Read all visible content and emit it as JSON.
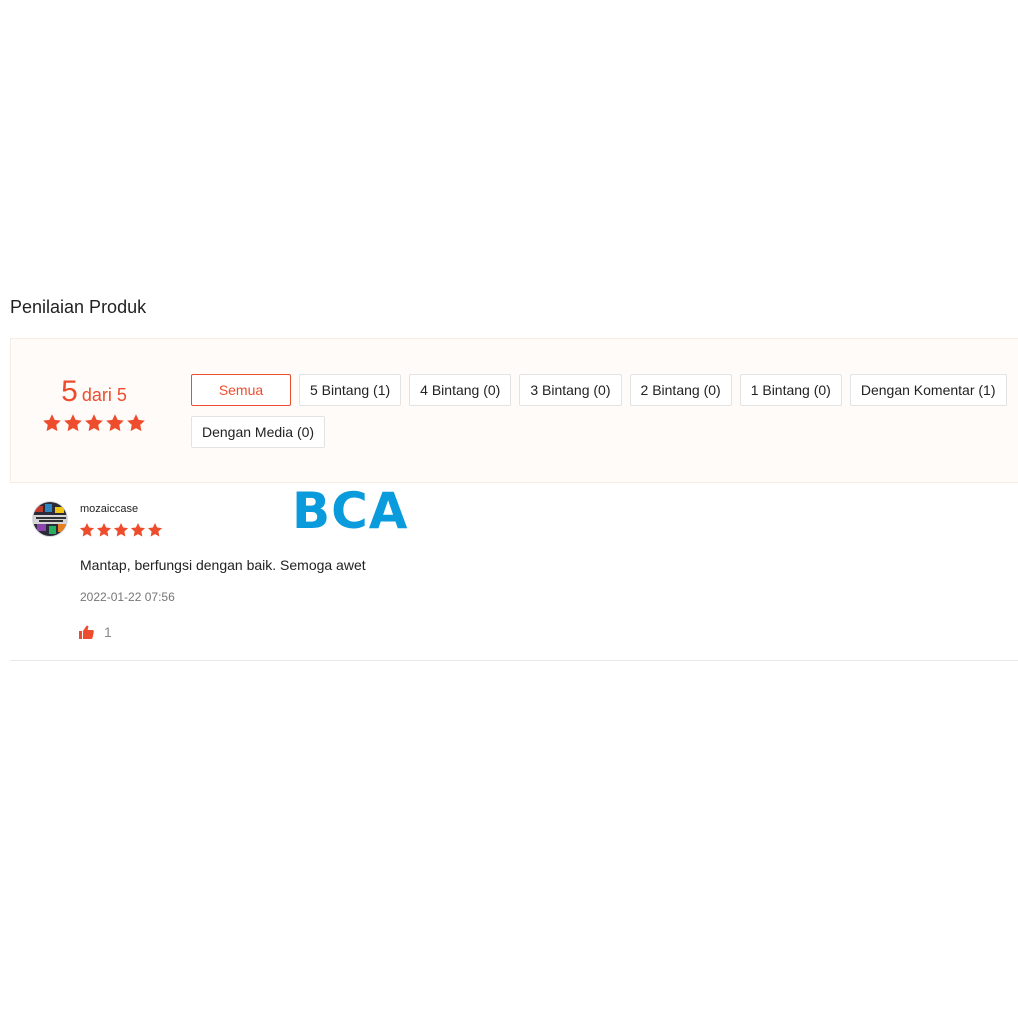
{
  "section": {
    "title": "Penilaian Produk"
  },
  "rating": {
    "score": "5",
    "suffix": "dari 5",
    "stars": 5
  },
  "filters": [
    {
      "label": "Semua",
      "active": true
    },
    {
      "label": "5 Bintang (1)",
      "active": false
    },
    {
      "label": "4 Bintang (0)",
      "active": false
    },
    {
      "label": "3 Bintang (0)",
      "active": false
    },
    {
      "label": "2 Bintang (0)",
      "active": false
    },
    {
      "label": "1 Bintang (0)",
      "active": false
    },
    {
      "label": "Dengan Komentar (1)",
      "active": false
    },
    {
      "label": "Dengan Media (0)",
      "active": false
    }
  ],
  "review": {
    "username": "mozaiccase",
    "stars": 5,
    "comment": "Mantap, berfungsi dengan baik. Semoga awet",
    "timestamp": "2022-01-22 07:56",
    "likes": "1"
  },
  "watermark": "BCA",
  "colors": {
    "accent": "#ee4d2d",
    "watermark": "#0a9bdc",
    "panel_bg": "#fffbf8"
  },
  "icons": {
    "star": "star-icon",
    "like": "thumbs-up-icon"
  }
}
